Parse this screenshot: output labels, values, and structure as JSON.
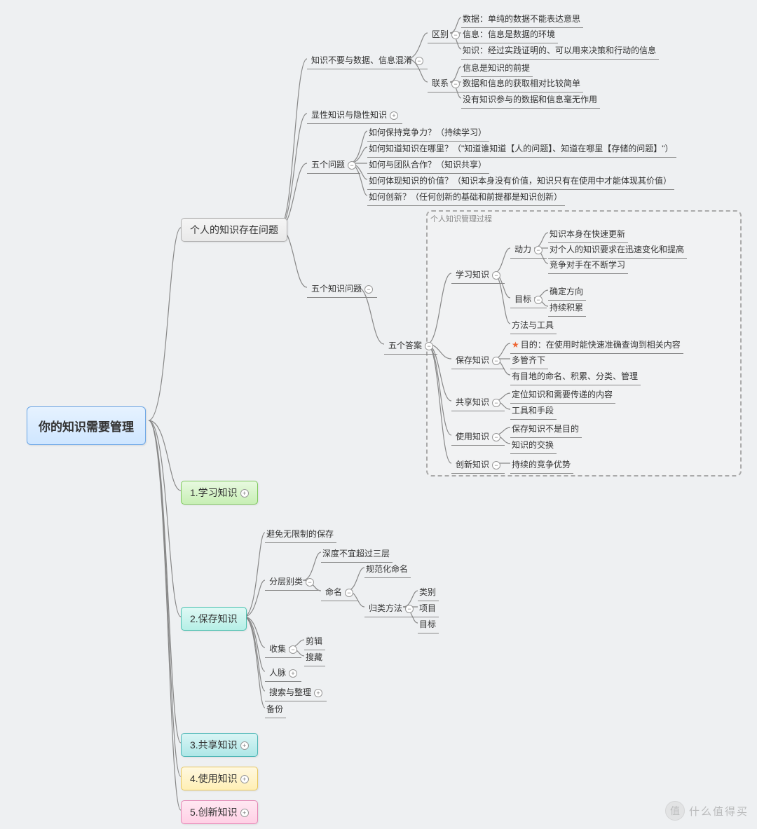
{
  "root": "你的知识需要管理",
  "b": {
    "personal": "个人的知识存在问题",
    "learn": "1.学习知识",
    "save": "2.保存知识",
    "share": "3.共享知识",
    "use": "4.使用知识",
    "innovate": "5.创新知识"
  },
  "p": {
    "confuse": "知识不要与数据、信息混淆",
    "explicit": "显性知识与隐性知识",
    "fiveQ": "五个问题",
    "fiveKnowQ": "五个知识问题",
    "fiveA": "五个答案"
  },
  "diff": {
    "label": "区别",
    "c1": "数据：单纯的数据不能表达意思",
    "c2": "信息：信息是数据的环境",
    "c3": "知识：经过实践证明的、可以用来决策和行动的信息"
  },
  "rel": {
    "label": "联系",
    "c1": "信息是知识的前提",
    "c2": "数据和信息的获取相对比较简单",
    "c3": "没有知识参与的数据和信息毫无作用"
  },
  "q": {
    "c1": "如何保持竞争力？（持续学习）",
    "c2": "如何知道知识在哪里？（\"知道谁知道【人的问题】、知道在哪里【存储的问题】\"）",
    "c3": "如何与团队合作？（知识共享）",
    "c4": "如何体现知识的价值？（知识本身没有价值，知识只有在使用中才能体现其价值）",
    "c5": "如何创新？（任何创新的基础和前提都是知识创新）"
  },
  "boundaryLabel": "个人知识管理过程",
  "ans": {
    "learn": "学习知识",
    "save": "保存知识",
    "share": "共享知识",
    "use": "使用知识",
    "inn": "创新知识",
    "dongli": "动力",
    "mubiao": "目标",
    "fangfa": "方法与工具",
    "d1": "知识本身在快速更新",
    "d2": "对个人的知识要求在迅速变化和提高",
    "d3": "竞争对手在不断学习",
    "m1": "确定方向",
    "m2": "持续积累",
    "s1": "目的：在使用时能快速准确查询到相关内容",
    "s2": "多管齐下",
    "s3": "有目地的命名、积累、分类、管理",
    "sh1": "定位知识和需要传递的内容",
    "sh2": "工具和手段",
    "u1": "保存知识不是目的",
    "u2": "知识的交换",
    "i1": "持续的竞争优势"
  },
  "save": {
    "avoid": "避免无限制的保存",
    "layer": "分层别类",
    "depth": "深度不宜超过三层",
    "naming": "命名",
    "std": "规范化命名",
    "method": "归类方法",
    "cat": "类别",
    "proj": "项目",
    "goal": "目标",
    "collect": "收集",
    "clip": "剪辑",
    "fav": "搜藏",
    "people": "人脉",
    "search": "搜索与整理",
    "backup": "备份"
  },
  "watermark": {
    "badge": "值",
    "text": "什么值得买"
  }
}
